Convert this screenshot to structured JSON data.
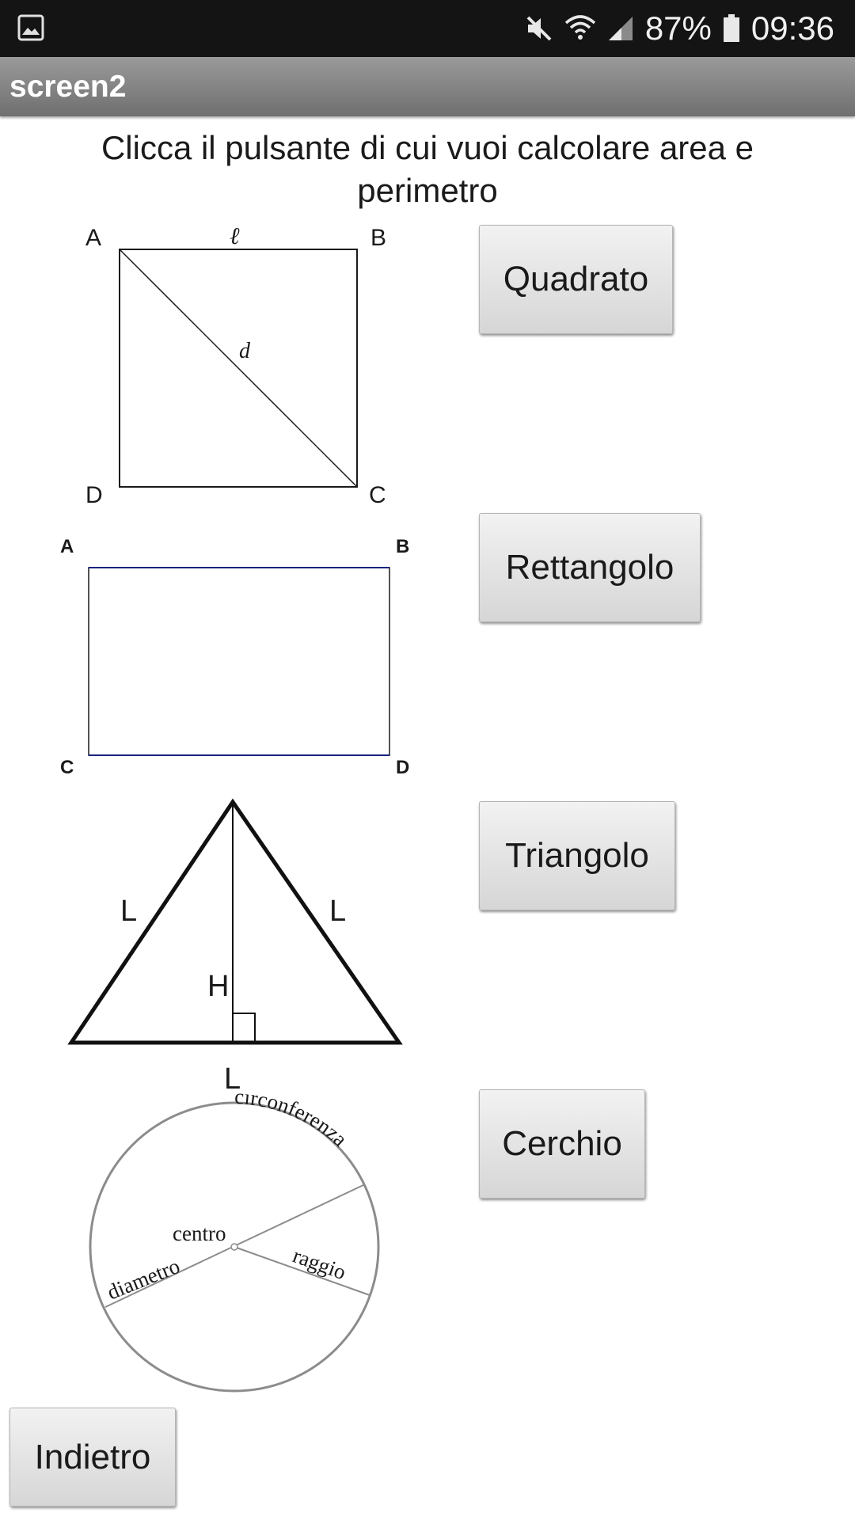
{
  "status_bar": {
    "battery": "87%",
    "time": "09:36",
    "icons": [
      "gallery-icon",
      "mute-icon",
      "wifi-icon",
      "signal-icon",
      "battery-icon"
    ]
  },
  "title_bar": {
    "title": "screen2"
  },
  "instruction": "Clicca il pulsante di cui vuoi calcolare area e perimetro",
  "figures": {
    "square": {
      "corner_a": "A",
      "corner_b": "B",
      "corner_c": "C",
      "corner_d": "D",
      "side": "ℓ",
      "diagonal": "d"
    },
    "rectangle": {
      "corner_a": "A",
      "corner_b": "B",
      "corner_c": "C",
      "corner_d": "D"
    },
    "triangle": {
      "left_side": "L",
      "right_side": "L",
      "height": "H",
      "base": "L"
    },
    "circle": {
      "circumference": "circonferenza",
      "center": "centro",
      "diameter": "diametro",
      "radius": "raggio"
    }
  },
  "buttons": {
    "square": "Quadrato",
    "rectangle": "Rettangolo",
    "triangle": "Triangolo",
    "circle": "Cerchio",
    "back": "Indietro"
  },
  "colors": {
    "status_bar": "#141414",
    "title_bar": "#8a8a8a",
    "rectangle_edge": "#1a237e"
  }
}
